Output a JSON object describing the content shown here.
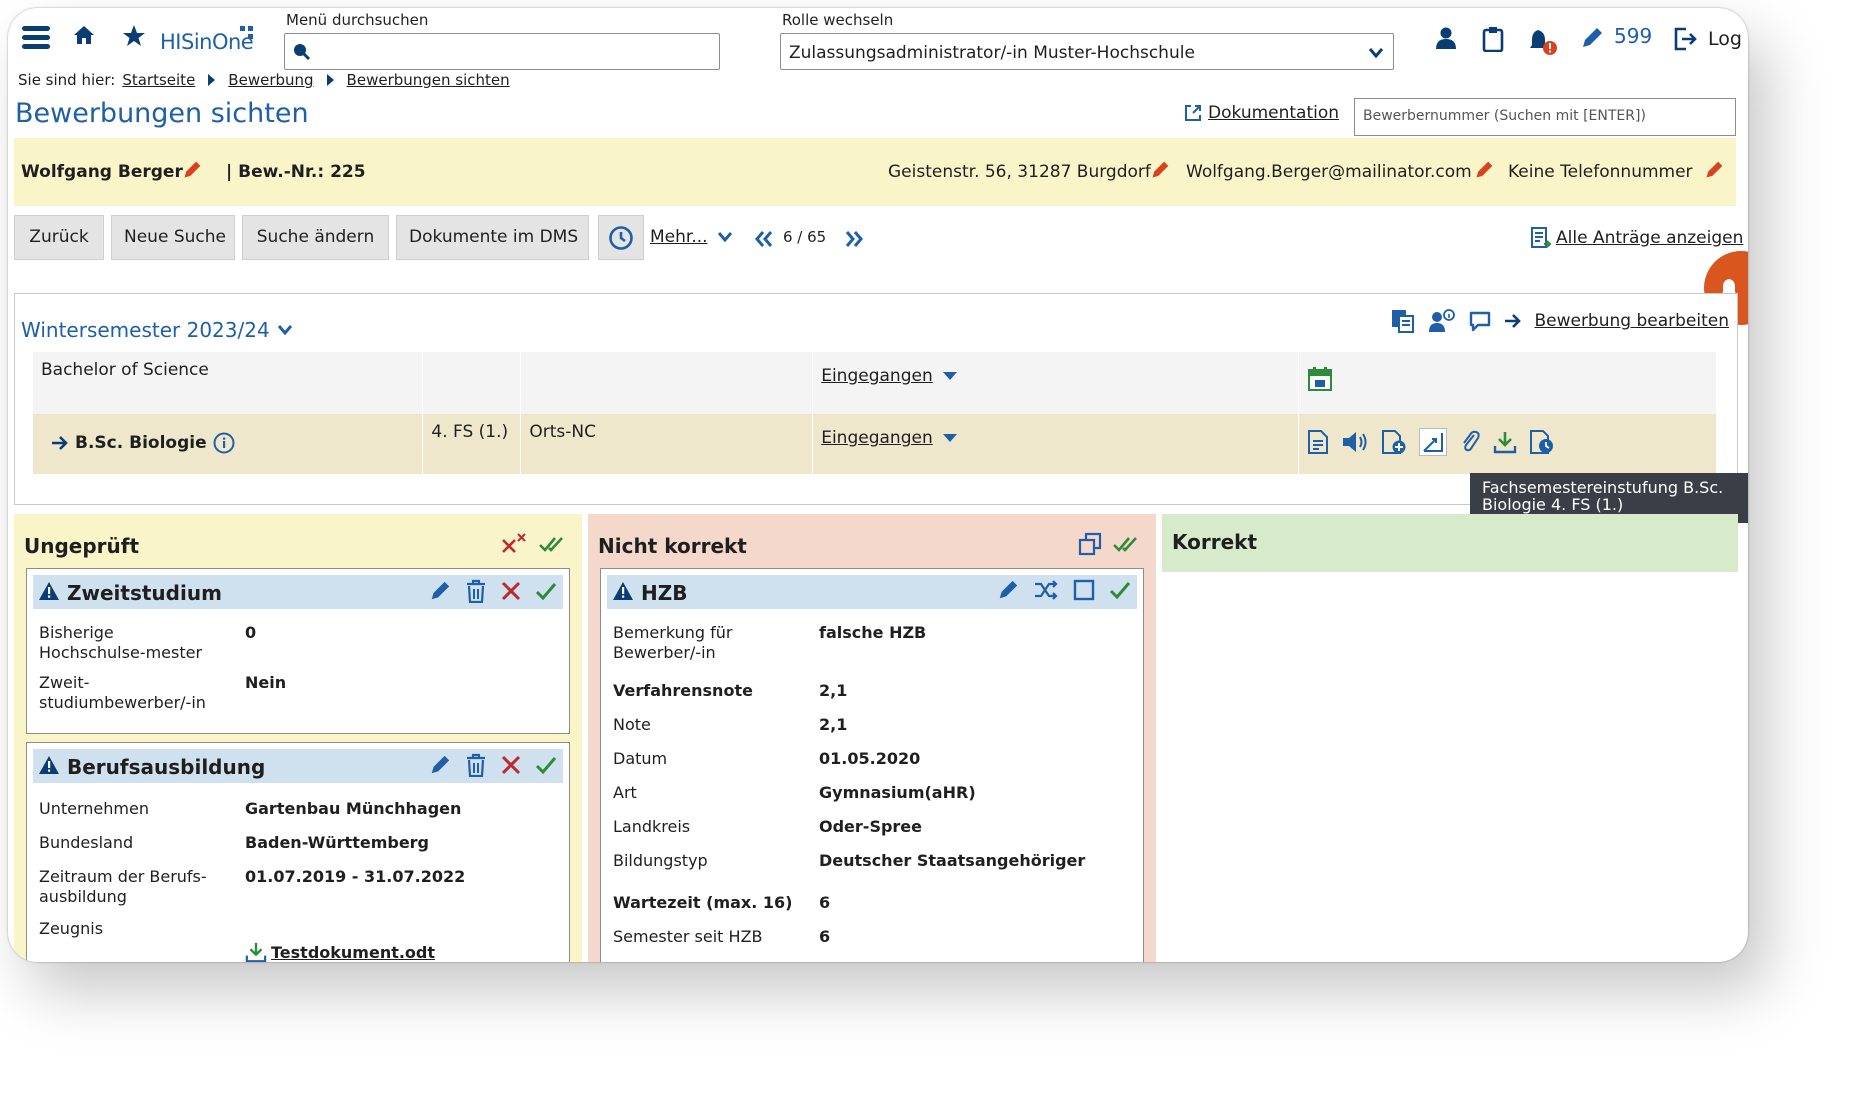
{
  "header": {
    "logo_text": "HISinOne",
    "menu_search_label": "Menü durchsuchen",
    "role_label": "Rolle wechseln",
    "role_value": "Zulassungsadministrator/-in Muster-Hochschule",
    "counter": "599",
    "logout_text": "Log"
  },
  "breadcrumb": {
    "prefix": "Sie sind hier:",
    "items": [
      "Startseite",
      "Bewerbung",
      "Bewerbungen sichten"
    ]
  },
  "page": {
    "title": "Bewerbungen sichten",
    "documentation_link": "Dokumentation",
    "applicant_search_placeholder": "Bewerbernummer (Suchen mit [ENTER])"
  },
  "applicant": {
    "name": "Wolfgang Berger",
    "number": "| Bew.-Nr.: 225",
    "address": "Geistenstr. 56, 31287 Burgdorf",
    "email": "Wolfgang.Berger@mailinator.com",
    "phone": "Keine Telefonnummer"
  },
  "toolbar": {
    "back": "Zurück",
    "new_search": "Neue Suche",
    "change_search": "Suche ändern",
    "dms_docs": "Dokumente im DMS",
    "more": "Mehr...",
    "pager": "6 / 65",
    "all_requests": "Alle Anträge anzeigen"
  },
  "semester": {
    "title": "Wintersemester 2023/24",
    "edit_application": "Bewerbung bearbeiten",
    "rows": [
      {
        "program": "Bachelor of Science",
        "fs": "",
        "type": "",
        "status": "Eingegangen"
      },
      {
        "program": "B.Sc. Biologie",
        "fs": "4. FS (1.)",
        "type": "Orts-NC",
        "status": "Eingegangen"
      }
    ],
    "tooltip": "Fachsemestereinstufung B.Sc. Biologie 4. FS (1.)"
  },
  "columns": {
    "unchecked": {
      "title": "Ungeprüft",
      "cards": [
        {
          "title": "Zweitstudium",
          "fields": [
            {
              "label": "Bisherige Hochschulse-mester",
              "value": "0"
            },
            {
              "label": "Zweit-studiumbewerber/-in",
              "value": "Nein"
            }
          ]
        },
        {
          "title": "Berufsausbildung",
          "fields": [
            {
              "label": "Unternehmen",
              "value": "Gartenbau Münchhagen"
            },
            {
              "label": "Bundesland",
              "value": "Baden-Württemberg"
            },
            {
              "label": "Zeitraum der Berufs-ausbildung",
              "value": "01.07.2019 - 31.07.2022"
            },
            {
              "label": "Zeugnis",
              "value": "Testdokument.odt"
            }
          ]
        }
      ]
    },
    "incorrect": {
      "title": "Nicht korrekt",
      "cards": [
        {
          "title": "HZB",
          "fields": [
            {
              "label": "Bemerkung für Bewerber/-in",
              "value": "falsche HZB"
            },
            {
              "label": "Verfahrensnote",
              "value": "2,1"
            },
            {
              "label": "Note",
              "value": "2,1"
            },
            {
              "label": "Datum",
              "value": "01.05.2020"
            },
            {
              "label": "Art",
              "value": "Gymnasium(aHR)"
            },
            {
              "label": "Landkreis",
              "value": "Oder-Spree"
            },
            {
              "label": "Bildungstyp",
              "value": "Deutscher Staatsangehöriger"
            },
            {
              "label": "Wartezeit (max. 16)",
              "value": "6"
            },
            {
              "label": "Semester seit HZB",
              "value": "6"
            }
          ]
        }
      ]
    },
    "correct": {
      "title": "Korrekt"
    }
  },
  "colors": {
    "brand_blue": "#1f5fa8",
    "dark_navy": "#0a3d73",
    "pencil_red": "#d9421e",
    "green_check": "#2e8b3a",
    "reject_red": "#c0282f",
    "banner_yellow": "#faf5c9",
    "card_blue": "#cfe1ef"
  }
}
